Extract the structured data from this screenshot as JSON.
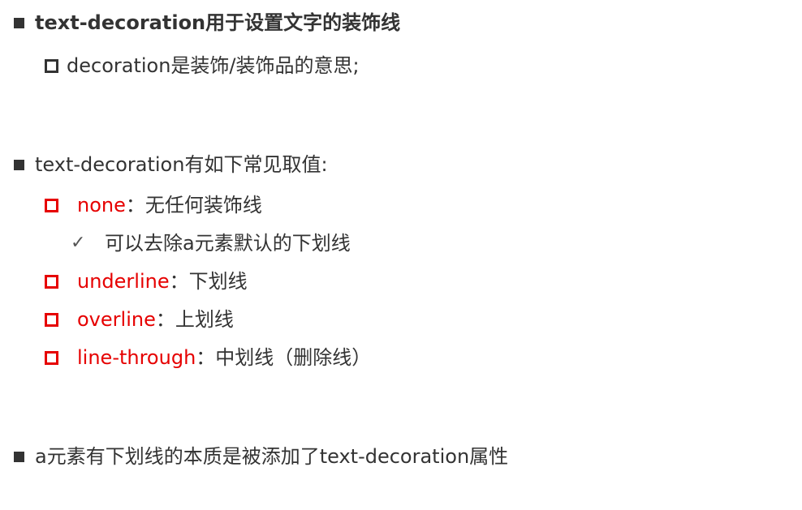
{
  "heading": {
    "text": "text-decoration用于设置文字的装饰线"
  },
  "decoration_note": {
    "text": "decoration是装饰/装饰品的意思;"
  },
  "values_intro": {
    "text": "text-decoration有如下常见取值:"
  },
  "values": [
    {
      "name": "none",
      "sep": "：",
      "desc": "无任何装饰线"
    },
    {
      "name": "underline",
      "sep": "：",
      "desc": "下划线"
    },
    {
      "name": "overline",
      "sep": "：",
      "desc": "上划线"
    },
    {
      "name": "line-through",
      "sep": "：",
      "desc": "中划线（删除线）"
    }
  ],
  "none_note": {
    "text": "可以去除a元素默认的下划线"
  },
  "conclusion": {
    "text": "a元素有下划线的本质是被添加了text-decoration属性"
  },
  "colors": {
    "accent": "#e60000",
    "text": "#333333"
  },
  "icons": {
    "solid": "filled-square-bullet",
    "hollow": "hollow-square-bullet",
    "check": "check-icon"
  }
}
